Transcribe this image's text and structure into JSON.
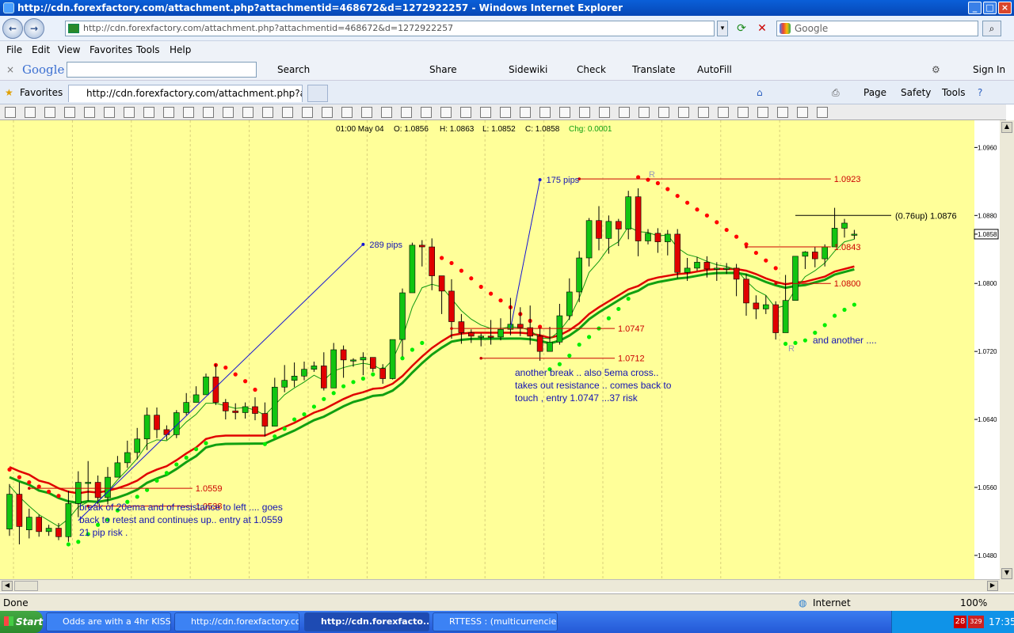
{
  "window": {
    "title": "http://cdn.forexfactory.com/attachment.php?attachmentid=468672&d=1272922257 - Windows Internet Explorer"
  },
  "address": {
    "url": "http://cdn.forexfactory.com/attachment.php?attachmentid=468672&d=1272922257",
    "search_placeholder": "Google"
  },
  "menu": [
    "File",
    "Edit",
    "View",
    "Favorites",
    "Tools",
    "Help"
  ],
  "google_toolbar": {
    "logo": "Google",
    "items": [
      "Search",
      "Share",
      "Sidewiki",
      "Check",
      "Translate",
      "AutoFill",
      "Sign In"
    ]
  },
  "favorites_bar": {
    "label": "Favorites",
    "tab_title": "http://cdn.forexfactory.com/attachment.php?attachme...",
    "commands": [
      "Page",
      "Safety",
      "Tools"
    ]
  },
  "chart_data": {
    "type": "candlestick",
    "info": {
      "time": "01:00 May 04",
      "open": "O: 1.0856",
      "high": "H: 1.0863",
      "low": "L: 1.0852",
      "close": "C: 1.0858",
      "change": "Chg: 0.0001"
    },
    "y_ticks": [
      "1.0960",
      "1.0880",
      "1.0858",
      "1.0800",
      "1.0720",
      "1.0640",
      "1.0560",
      "1.0480"
    ],
    "ylim": [
      1.0452,
      1.0992
    ],
    "candles": [
      [
        1.0511,
        1.0552,
        1.0503,
        1.0564
      ],
      [
        1.0552,
        1.0514,
        1.0493,
        1.0566
      ],
      [
        1.051,
        1.0525,
        1.05,
        1.0535
      ],
      [
        1.0525,
        1.0508,
        1.0502,
        1.0528
      ],
      [
        1.0508,
        1.0512,
        1.0503,
        1.0516
      ],
      [
        1.0512,
        1.0502,
        1.0498,
        1.0518
      ],
      [
        1.0502,
        1.0541,
        1.0496,
        1.0556
      ],
      [
        1.0541,
        1.0566,
        1.0525,
        1.0579
      ],
      [
        1.0566,
        1.0566,
        1.0544,
        1.0591
      ],
      [
        1.0566,
        1.0548,
        1.054,
        1.0574
      ],
      [
        1.0548,
        1.0572,
        1.054,
        1.0584
      ],
      [
        1.0572,
        1.0589,
        1.0572,
        1.0597
      ],
      [
        1.0589,
        1.0601,
        1.0583,
        1.0615
      ],
      [
        1.0601,
        1.0617,
        1.0593,
        1.063
      ],
      [
        1.0617,
        1.0645,
        1.0604,
        1.0654
      ],
      [
        1.0645,
        1.0628,
        1.0618,
        1.0654
      ],
      [
        1.0628,
        1.0622,
        1.0616,
        1.0633
      ],
      [
        1.0622,
        1.0648,
        1.0618,
        1.0651
      ],
      [
        1.0648,
        1.066,
        1.0645,
        1.0671
      ],
      [
        1.066,
        1.0669,
        1.066,
        1.0679
      ],
      [
        1.0669,
        1.069,
        1.0669,
        1.0694
      ],
      [
        1.069,
        1.066,
        1.0657,
        1.0705
      ],
      [
        1.066,
        1.065,
        1.064,
        1.0664
      ],
      [
        1.065,
        1.0648,
        1.064,
        1.0659
      ],
      [
        1.0648,
        1.0655,
        1.0641,
        1.066
      ],
      [
        1.0655,
        1.0647,
        1.0639,
        1.0666
      ],
      [
        1.0647,
        1.0632,
        1.062,
        1.066
      ],
      [
        1.0632,
        1.0678,
        1.0632,
        1.0689
      ],
      [
        1.0678,
        1.0686,
        1.0672,
        1.0704
      ],
      [
        1.0686,
        1.0691,
        1.0678,
        1.0707
      ],
      [
        1.0691,
        1.0699,
        1.0686,
        1.0708
      ],
      [
        1.0699,
        1.0703,
        1.0696,
        1.0708
      ],
      [
        1.0703,
        1.0677,
        1.0674,
        1.0719
      ],
      [
        1.0677,
        1.0722,
        1.0677,
        1.073
      ],
      [
        1.0722,
        1.071,
        1.0689,
        1.0727
      ],
      [
        1.071,
        1.071,
        1.0702,
        1.0712
      ],
      [
        1.071,
        1.0713,
        1.0692,
        1.0719
      ],
      [
        1.0713,
        1.07,
        1.0696,
        1.0713
      ],
      [
        1.07,
        1.0688,
        1.0682,
        1.0705
      ],
      [
        1.0688,
        1.0734,
        1.0687,
        1.0734
      ],
      [
        1.0734,
        1.0789,
        1.0714,
        1.0794
      ],
      [
        1.0789,
        1.0845,
        1.0789,
        1.0848
      ],
      [
        1.0845,
        1.0843,
        1.082,
        1.0851
      ],
      [
        1.0843,
        1.0809,
        1.0792,
        1.0853
      ],
      [
        1.0809,
        1.0791,
        1.0764,
        1.0798
      ],
      [
        1.0791,
        1.0755,
        1.0735,
        1.0805
      ],
      [
        1.0755,
        1.0742,
        1.0729,
        1.0764
      ],
      [
        1.0742,
        1.0738,
        1.073,
        1.0746
      ],
      [
        1.0738,
        1.0738,
        1.0726,
        1.0741
      ],
      [
        1.0738,
        1.0737,
        1.0728,
        1.0757
      ],
      [
        1.0737,
        1.0746,
        1.0733,
        1.0759
      ],
      [
        1.0746,
        1.0752,
        1.0739,
        1.0783
      ],
      [
        1.0752,
        1.0748,
        1.0738,
        1.0772
      ],
      [
        1.0748,
        1.0738,
        1.0728,
        1.0774
      ],
      [
        1.0738,
        1.072,
        1.0709,
        1.0748
      ],
      [
        1.072,
        1.0731,
        1.0722,
        1.0749
      ],
      [
        1.0731,
        1.0762,
        1.0728,
        1.0776
      ],
      [
        1.0762,
        1.079,
        1.0757,
        1.0806
      ],
      [
        1.079,
        1.083,
        1.0778,
        1.0838
      ],
      [
        1.083,
        1.0874,
        1.082,
        1.0877
      ],
      [
        1.0874,
        1.0853,
        1.0839,
        1.0891
      ],
      [
        1.0853,
        1.0873,
        1.0835,
        1.088
      ],
      [
        1.0873,
        1.0864,
        1.0844,
        1.0876
      ],
      [
        1.0864,
        1.0902,
        1.0852,
        1.0909
      ],
      [
        1.0902,
        1.085,
        1.0832,
        1.0912
      ],
      [
        1.085,
        1.0859,
        1.0846,
        1.0864
      ],
      [
        1.0859,
        1.0849,
        1.0836,
        1.0865
      ],
      [
        1.0849,
        1.0858,
        1.0833,
        1.0863
      ],
      [
        1.0858,
        1.0813,
        1.0806,
        1.0864
      ],
      [
        1.0813,
        1.0818,
        1.0803,
        1.083
      ],
      [
        1.0818,
        1.0825,
        1.0815,
        1.0831
      ],
      [
        1.0825,
        1.0817,
        1.0807,
        1.0832
      ],
      [
        1.0817,
        1.0818,
        1.0803,
        1.0825
      ],
      [
        1.0818,
        1.0818,
        1.0811,
        1.0824
      ],
      [
        1.0818,
        1.0805,
        1.0785,
        1.0823
      ],
      [
        1.0805,
        1.0777,
        1.0762,
        1.0811
      ],
      [
        1.0777,
        1.077,
        1.0758,
        1.0786
      ],
      [
        1.077,
        1.0775,
        1.0764,
        1.0786
      ],
      [
        1.0775,
        1.0742,
        1.0734,
        1.0779
      ],
      [
        1.0742,
        1.078,
        1.0762,
        1.081
      ],
      [
        1.078,
        1.0832,
        1.0784,
        1.0832
      ],
      [
        1.0832,
        1.0837,
        1.0817,
        1.0838
      ],
      [
        1.0837,
        1.0829,
        1.0819,
        1.0843
      ],
      [
        1.0829,
        1.0843,
        1.082,
        1.0846
      ],
      [
        1.0843,
        1.0865,
        1.0843,
        1.0889
      ],
      [
        1.0865,
        1.0871,
        1.0854,
        1.0876
      ],
      [
        1.0858,
        1.0858,
        1.0852,
        1.0863
      ]
    ],
    "sar": [
      [
        1.0581,
        1.0572,
        1.0566,
        1.0561,
        1.0555,
        1.055,
        null,
        null,
        null,
        null,
        null,
        null,
        null,
        null,
        null,
        null,
        null,
        null,
        null,
        null,
        null,
        1.0704,
        1.0701,
        1.0693,
        1.0685,
        1.0675,
        null,
        null,
        null,
        null,
        null,
        null,
        null,
        null,
        null,
        null,
        null,
        null,
        null,
        null,
        null,
        null,
        null,
        null,
        1.083,
        1.0824,
        1.0815,
        1.0806,
        1.0796,
        1.0788,
        1.078,
        1.0772,
        1.0764,
        1.0756,
        1.0749,
        null,
        null,
        null,
        null,
        null,
        null,
        null,
        null,
        null,
        1.0925,
        1.0922,
        1.0918,
        1.0911,
        1.0903,
        1.0895,
        1.0887,
        1.088,
        1.0872,
        1.0863,
        1.0855,
        1.0846,
        1.0836,
        1.0827,
        1.0818,
        null,
        null,
        null,
        null,
        null,
        null,
        null,
        null
      ],
      [
        null,
        null,
        null,
        null,
        null,
        null,
        1.0493,
        1.0496,
        1.0505,
        1.0516,
        1.0522,
        1.0533,
        1.0543,
        1.0549,
        1.0557,
        1.0568,
        1.0577,
        1.0587,
        1.0595,
        1.0605,
        1.0612,
        null,
        null,
        null,
        null,
        null,
        1.0611,
        1.062,
        1.0629,
        1.064,
        1.0646,
        1.0655,
        1.0664,
        1.0671,
        1.0679,
        1.0684,
        1.0688,
        1.0693,
        1.0699,
        1.0705,
        1.0712,
        1.0722,
        1.073,
        null,
        null,
        null,
        null,
        null,
        null,
        null,
        null,
        null,
        null,
        null,
        null,
        1.0699,
        1.0705,
        1.0715,
        1.0728,
        1.0737,
        1.0747,
        1.0759,
        1.077,
        1.0782,
        null,
        null,
        null,
        null,
        null,
        null,
        null,
        null,
        null,
        null,
        null,
        null,
        null,
        null,
        null,
        1.0729,
        1.073,
        1.0733,
        1.0742,
        1.0751,
        1.0762,
        1.0769,
        1.0775
      ]
    ],
    "ema20": [
      1.0584,
      1.0579,
      1.0575,
      1.0568,
      1.0565,
      1.0559,
      1.0555,
      1.0553,
      1.0555,
      1.0554,
      1.0556,
      1.0559,
      1.0563,
      1.0568,
      1.0576,
      1.0581,
      1.0585,
      1.0592,
      1.06,
      1.0607,
      1.0617,
      1.062,
      1.0621,
      1.0621,
      1.0621,
      1.0621,
      1.0621,
      1.0626,
      1.0631,
      1.0636,
      1.0642,
      1.0648,
      1.0652,
      1.0658,
      1.0664,
      1.0669,
      1.0672,
      1.0676,
      1.0677,
      1.0682,
      1.0691,
      1.0703,
      1.0714,
      1.0724,
      1.0732,
      1.0739,
      1.0741,
      1.0742,
      1.0742,
      1.0742,
      1.0742,
      1.0742,
      1.0742,
      1.0741,
      1.0739,
      1.0736,
      1.0739,
      1.0745,
      1.0753,
      1.0764,
      1.0772,
      1.0779,
      1.0786,
      1.0793,
      1.0797,
      1.0804,
      1.0807,
      1.0809,
      1.0811,
      1.0812,
      1.0814,
      1.0816,
      1.0817,
      1.0817,
      1.0817,
      1.0815,
      1.0811,
      1.0806,
      1.0802,
      1.0799,
      1.0801,
      1.0802,
      1.0805,
      1.0808,
      1.0814,
      1.0817,
      1.082
    ],
    "ema5": [
      1.0562,
      1.0549,
      1.0538,
      1.0528,
      1.0521,
      1.0514,
      1.0523,
      1.0537,
      1.0543,
      1.0544,
      1.0555,
      1.0569,
      1.0581,
      1.0594,
      1.0611,
      1.0616,
      1.0615,
      1.0625,
      1.0637,
      1.0646,
      1.0659,
      1.0659,
      1.0656,
      1.0653,
      1.0654,
      1.0651,
      1.0645,
      1.0657,
      1.0669,
      1.0677,
      1.0684,
      1.0692,
      1.0686,
      1.0697,
      1.0701,
      1.0704,
      1.0706,
      1.0704,
      1.0698,
      1.071,
      1.0736,
      1.0772,
      1.0795,
      1.0799,
      1.0796,
      1.0782,
      1.0768,
      1.0758,
      1.0751,
      1.0747,
      1.0747,
      1.0749,
      1.0748,
      1.0745,
      1.0736,
      1.0735,
      1.0744,
      1.0759,
      1.0783,
      1.0813,
      1.0826,
      1.0842,
      1.0849,
      1.0867,
      1.0861,
      1.086,
      1.0856,
      1.0857,
      1.0842,
      1.0834,
      1.0831,
      1.0826,
      1.0822,
      1.082,
      1.0816,
      1.0803,
      1.0792,
      1.0786,
      1.0771,
      1.0774,
      1.0793,
      1.0808,
      1.0815,
      1.0824,
      1.0838,
      1.0849,
      1.0852
    ],
    "levels": [
      {
        "label": "1.0559",
        "value": 1.0559,
        "from": 2,
        "to": 17
      },
      {
        "label": "1.0538",
        "value": 1.0538,
        "from": 8,
        "to": 17
      },
      {
        "label": "1.0747",
        "value": 1.0747,
        "from": 45,
        "to": 60
      },
      {
        "label": "1.0712",
        "value": 1.0712,
        "from": 48,
        "to": 60
      },
      {
        "label": "1.0923",
        "value": 1.0923,
        "from": 58,
        "to": 82
      },
      {
        "label": "1.0843",
        "value": 1.0843,
        "from": 75,
        "to": 82
      },
      {
        "label": "1.0800",
        "value": 1.08,
        "from": 78,
        "to": 82
      }
    ],
    "trendlines": [
      {
        "label": "289 pips",
        "x1": 7,
        "y1": 1.0521,
        "x2": 36,
        "y2": 1.0846
      },
      {
        "label": "175 pips",
        "x1": 51,
        "y1": 1.0747,
        "x2": 54,
        "y2": 1.0922
      }
    ],
    "current_marker": {
      "label": "(0.76up)   1.0876",
      "value": 1.088
    },
    "markers": [
      "R",
      "R"
    ],
    "annotations": [
      "break of 20ema and of resistance to left .... goes",
      "back to retest and continues up.. entry at 1.0559",
      "21 pip risk .",
      "another break .. also 5ema cross..",
      "takes out resistance .. comes back to",
      "touch , entry 1.0747 ...37 risk",
      "and another ...."
    ],
    "colors": {
      "background": "#ffff99",
      "bull": "#11c411",
      "bear": "#e00000",
      "ema20": "#e00000",
      "ema50": "#11a011",
      "ema5": "#119911",
      "sar_bear": "#ff0000",
      "sar_bull": "#00ee00",
      "annotation": "#1414b4",
      "level": "#cc0000"
    }
  },
  "status": {
    "left": "Done",
    "zone": "Internet",
    "zoom": "100%"
  },
  "taskbar": {
    "start": "Start",
    "tasks": [
      "Odds are with a 4hr KISS ...",
      "http://cdn.forexfactory.co...",
      "http://cdn.forexfacto...",
      "RTTESS : (multicurrencie..."
    ],
    "tray_badge_1": "28",
    "tray_badge_2": "329",
    "clock": "17:35"
  }
}
